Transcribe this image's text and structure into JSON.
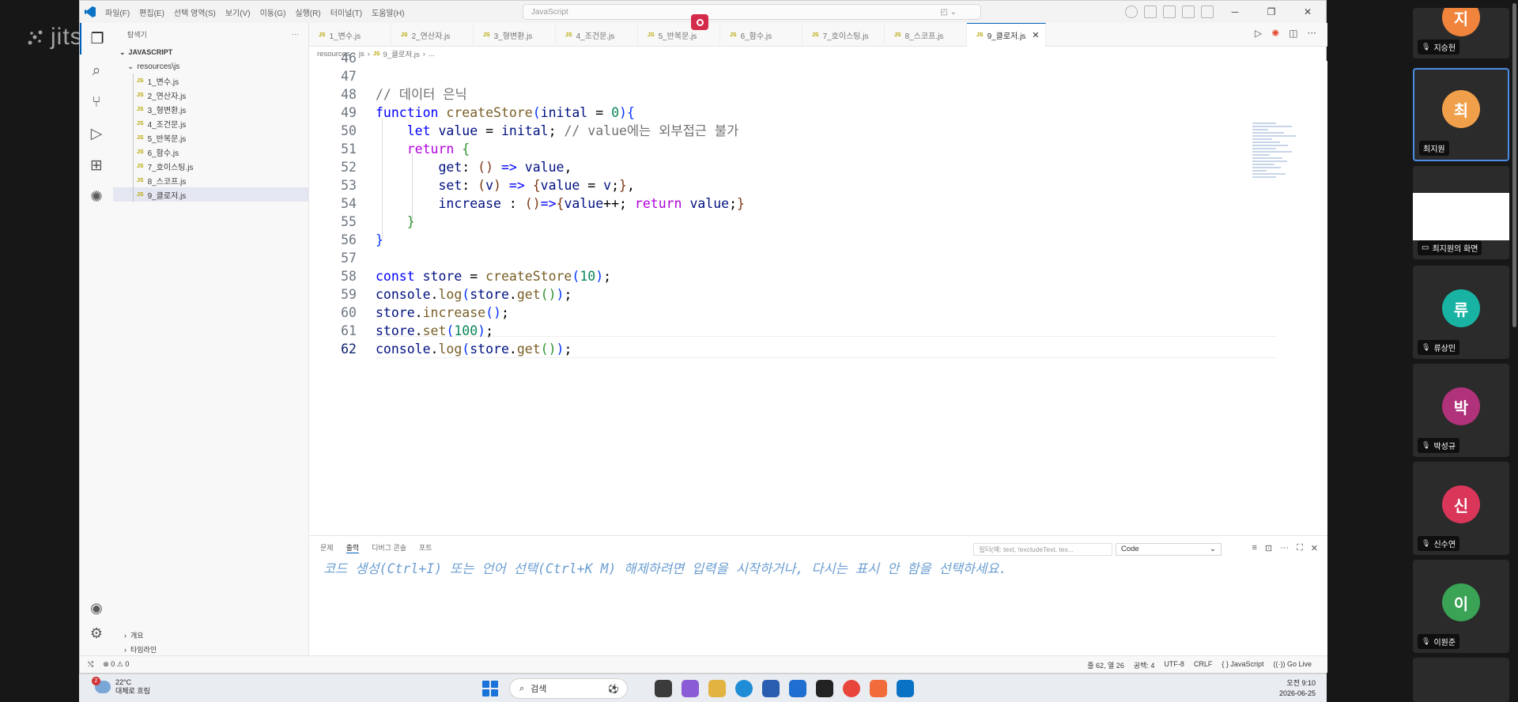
{
  "jitsi": {
    "logo": "jitsi"
  },
  "window": {
    "menu": [
      "파일(F)",
      "편집(E)",
      "선택 영역(S)",
      "보기(V)",
      "이동(G)",
      "실행(R)",
      "터미널(T)",
      "도움말(H)"
    ],
    "command_center": "JavaScript",
    "explorer_title": "탐색기",
    "workspace": "JAVASCRIPT",
    "folder": "resources\\js",
    "files": [
      "1_변수.js",
      "2_연산자.js",
      "3_형변환.js",
      "4_조건문.js",
      "5_반복문.js",
      "6_함수.js",
      "7_호이스팅.js",
      "8_스코프.js",
      "9_클로저.js"
    ],
    "tabs": [
      "1_변수.js",
      "2_연산자.js",
      "3_형변환.js",
      "4_조건문.js",
      "5_반복문.js",
      "6_함수.js",
      "7_호이스팅.js",
      "8_스코프.js",
      "9_클로저.js"
    ],
    "active_tab": "9_클로저.js",
    "breadcrumb": [
      "resources",
      "js",
      "9_클로저.js",
      "..."
    ],
    "outline": "개요",
    "timeline": "타임라인",
    "code_lines": [
      46,
      47,
      48,
      49,
      50,
      51,
      52,
      53,
      54,
      55,
      56,
      57,
      58,
      59,
      60,
      61,
      62
    ]
  },
  "panel": {
    "tabs": [
      "문제",
      "출력",
      "디버그 콘솔",
      "포트"
    ],
    "active": "출력",
    "filter_placeholder": "필터(예: text, !excludeText, tex...",
    "channel": "Code",
    "hint": "코드 생성(Ctrl+I) 또는 언어 선택(Ctrl+K M) 해제하려면 입력을 시작하거나, 다시는 표시 안 함을 선택하세요."
  },
  "status": {
    "problems": "⊗ 0 ⚠ 0",
    "position": "줄 62, 열 26",
    "spaces": "공백: 4",
    "encoding": "UTF-8",
    "eol": "CRLF",
    "language": "{ } JavaScript",
    "golive": "Go Live"
  },
  "taskbar": {
    "badge": "2",
    "temp": "22°C",
    "weather": "대체로 흐림",
    "search": "검색",
    "time": "오전 9:10",
    "date": "2026-06-25"
  },
  "participants": [
    {
      "initial": "지",
      "name": "지승헌",
      "color": "#f0843c"
    },
    {
      "initial": "최",
      "name": "최지원",
      "color": "#f0a04a"
    },
    {
      "initial": "",
      "name": "최지원의 화면",
      "color": ""
    },
    {
      "initial": "류",
      "name": "류상민",
      "color": "#19b3a3"
    },
    {
      "initial": "박",
      "name": "박성규",
      "color": "#b0327a"
    },
    {
      "initial": "신",
      "name": "신수연",
      "color": "#d9365a"
    },
    {
      "initial": "이",
      "name": "이원준",
      "color": "#3aa356"
    }
  ]
}
